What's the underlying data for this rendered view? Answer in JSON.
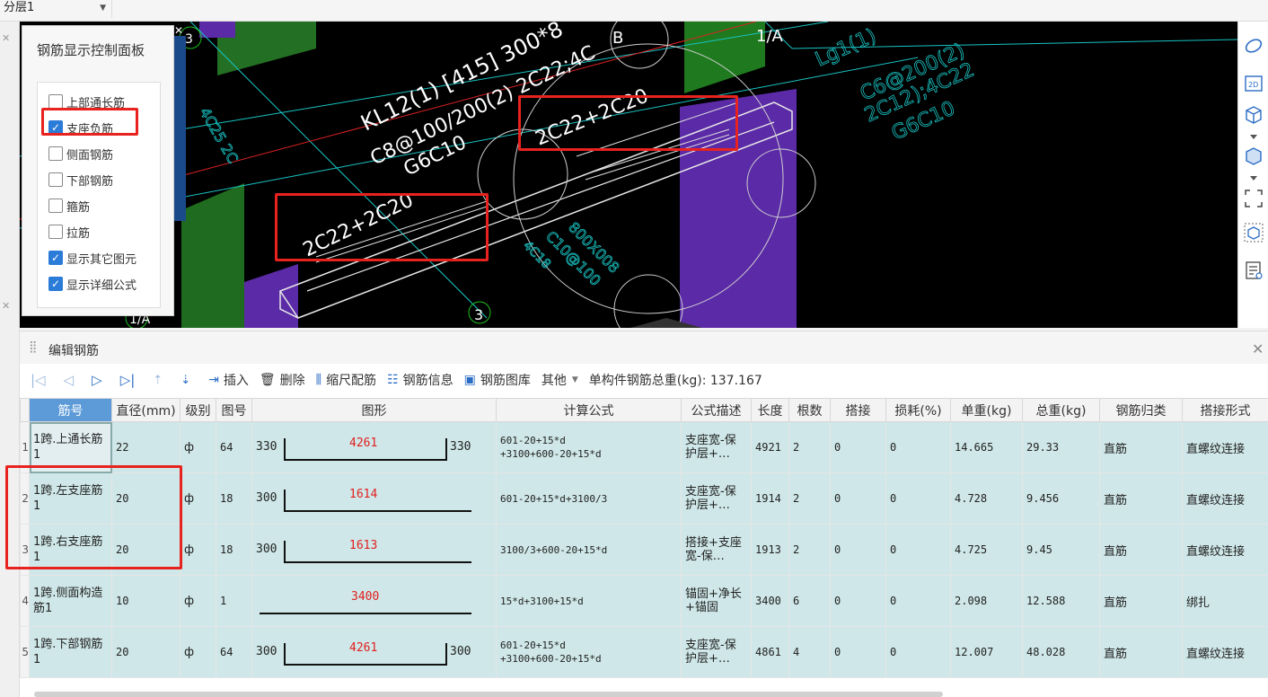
{
  "layer_select": {
    "value": "分层1"
  },
  "canvas": {
    "texts": {
      "kl": "KL12(1) [415] 300*8",
      "stirrup": "C8@100/200(2) 2C22;4C",
      "side": "G6C10",
      "leftseat": "2C22+2C20",
      "rightseat": "2C22+2C20",
      "axis_b": "B",
      "axis_1a": "1/A",
      "axis_3": "3",
      "axis_3b": "3",
      "lg1": "Lg1(1)",
      "lg2": "C6@200(2)",
      "lg3": "2C12);4C22",
      "lg4": "G6C10",
      "left_beam": "4C25 2C",
      "mid1": "800X008",
      "mid2": "C10@100",
      "mid3": "4C18",
      "axis_left": "1/A"
    }
  },
  "control_panel": {
    "title": "钢筋显示控制面板",
    "items": [
      {
        "label": "上部通长筋",
        "checked": false
      },
      {
        "label": "支座负筋",
        "checked": true
      },
      {
        "label": "侧面钢筋",
        "checked": false
      },
      {
        "label": "下部钢筋",
        "checked": false
      },
      {
        "label": "箍筋",
        "checked": false
      },
      {
        "label": "拉筋",
        "checked": false
      },
      {
        "label": "显示其它图元",
        "checked": true
      },
      {
        "label": "显示详细公式",
        "checked": true
      }
    ]
  },
  "edit_panel": {
    "title": "编辑钢筋",
    "toolbar": {
      "insert": "插入",
      "delete": "删除",
      "scale": "缩尺配筋",
      "info": "钢筋信息",
      "library": "钢筋图库",
      "other": "其他",
      "total": "单构件钢筋总重(kg): 137.167"
    },
    "columns": [
      "筋号",
      "直径(mm)",
      "级别",
      "图号",
      "图形",
      "计算公式",
      "公式描述",
      "长度",
      "根数",
      "搭接",
      "损耗(%)",
      "单重(kg)",
      "总重(kg)",
      "钢筋归类",
      "搭接形式"
    ],
    "rows": [
      {
        "no": "1",
        "name": "1跨.上通长筋1",
        "dia": "22",
        "grade": "ф",
        "fig": "64",
        "shape_l": "330",
        "shape_m": "4261",
        "shape_r": "330",
        "shape_type": "u",
        "formula": "601-20+15*d\n+3100+600-20+15*d",
        "desc": "支座宽-保护层+…",
        "len": "4921",
        "count": "2",
        "lap": "0",
        "loss": "0",
        "unit_w": "14.665",
        "total_w": "29.33",
        "cls": "直筋",
        "lap_type": "直螺纹连接"
      },
      {
        "no": "2",
        "name": "1跨.左支座筋1",
        "dia": "20",
        "grade": "ф",
        "fig": "18",
        "shape_l": "300",
        "shape_m": "1614",
        "shape_r": "",
        "shape_type": "l",
        "formula": "601-20+15*d+3100/3",
        "desc": "支座宽-保护层+…",
        "len": "1914",
        "count": "2",
        "lap": "0",
        "loss": "0",
        "unit_w": "4.728",
        "total_w": "9.456",
        "cls": "直筋",
        "lap_type": "直螺纹连接"
      },
      {
        "no": "3",
        "name": "1跨.右支座筋1",
        "dia": "20",
        "grade": "ф",
        "fig": "18",
        "shape_l": "300",
        "shape_m": "1613",
        "shape_r": "",
        "shape_type": "l",
        "formula": "3100/3+600-20+15*d",
        "desc": "搭接+支座宽-保…",
        "len": "1913",
        "count": "2",
        "lap": "0",
        "loss": "0",
        "unit_w": "4.725",
        "total_w": "9.45",
        "cls": "直筋",
        "lap_type": "直螺纹连接"
      },
      {
        "no": "4",
        "name": "1跨.侧面构造筋1",
        "dia": "10",
        "grade": "ф",
        "fig": "1",
        "shape_l": "",
        "shape_m": "3400",
        "shape_r": "",
        "shape_type": "line",
        "formula": "15*d+3100+15*d",
        "desc": "锚固+净长+锚固",
        "len": "3400",
        "count": "6",
        "lap": "0",
        "loss": "0",
        "unit_w": "2.098",
        "total_w": "12.588",
        "cls": "直筋",
        "lap_type": "绑扎"
      },
      {
        "no": "5",
        "name": "1跨.下部钢筋1",
        "dia": "20",
        "grade": "ф",
        "fig": "64",
        "shape_l": "300",
        "shape_m": "4261",
        "shape_r": "300",
        "shape_type": "u",
        "formula": "601-20+15*d\n+3100+600-20+15*d",
        "desc": "支座宽-保护层+…",
        "len": "4861",
        "count": "4",
        "lap": "0",
        "loss": "0",
        "unit_w": "12.007",
        "total_w": "48.028",
        "cls": "直筋",
        "lap_type": "直螺纹连接"
      }
    ]
  }
}
